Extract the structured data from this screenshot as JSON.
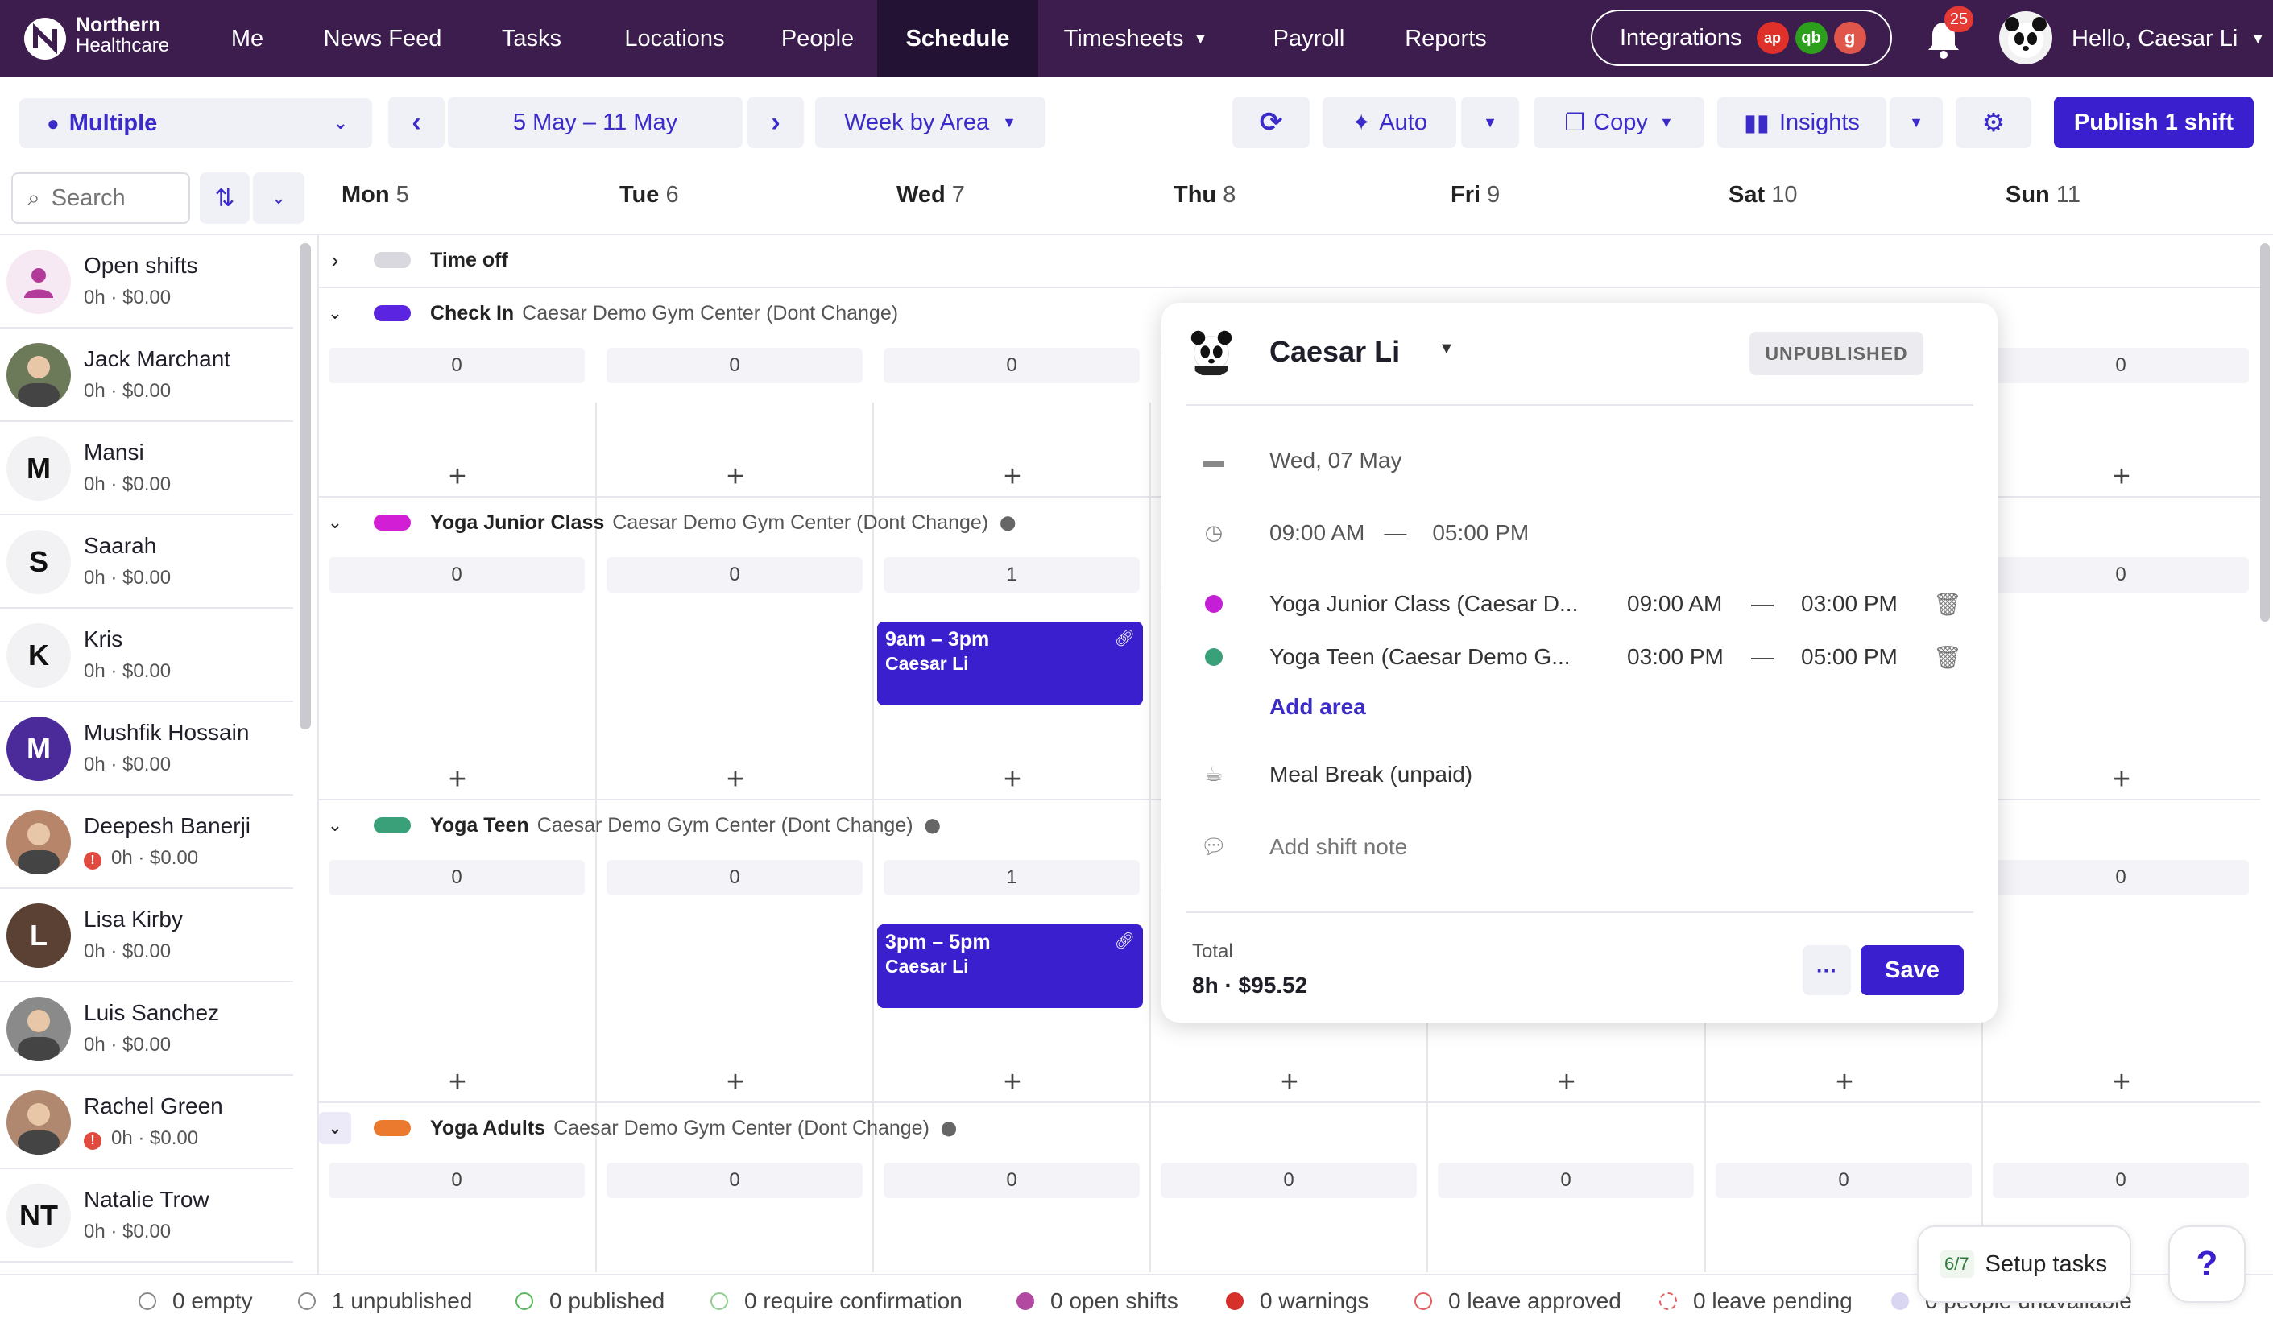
{
  "brand": {
    "line1": "Northern",
    "line2": "Healthcare"
  },
  "nav": {
    "items": [
      "Me",
      "News Feed",
      "Tasks",
      "Locations",
      "People",
      "Schedule",
      "Timesheets",
      "Payroll",
      "Reports"
    ],
    "active": "Schedule"
  },
  "integrations": {
    "label": "Integrations",
    "badges": [
      "ap",
      "qb",
      "g"
    ]
  },
  "notifications": {
    "count": "25"
  },
  "user": {
    "greeting": "Hello, Caesar Li"
  },
  "toolbar": {
    "location": "Multiple",
    "date_range": "5 May – 11 May",
    "view": "Week by Area",
    "auto": "Auto",
    "copy": "Copy",
    "insights": "Insights",
    "publish": "Publish 1 shift"
  },
  "search": {
    "placeholder": "Search"
  },
  "days": [
    {
      "d": "Mon",
      "n": "5"
    },
    {
      "d": "Tue",
      "n": "6"
    },
    {
      "d": "Wed",
      "n": "7"
    },
    {
      "d": "Thu",
      "n": "8"
    },
    {
      "d": "Fri",
      "n": "9"
    },
    {
      "d": "Sat",
      "n": "10"
    },
    {
      "d": "Sun",
      "n": "11"
    }
  ],
  "people": [
    {
      "name": "Open shifts",
      "meta": "0h · $0.00",
      "initials": "",
      "warn": false
    },
    {
      "name": "Jack Marchant",
      "meta": "0h · $0.00",
      "initials": "",
      "warn": false
    },
    {
      "name": "Mansi",
      "meta": "0h · $0.00",
      "initials": "M",
      "warn": false
    },
    {
      "name": "Saarah",
      "meta": "0h · $0.00",
      "initials": "S",
      "warn": false
    },
    {
      "name": "Kris",
      "meta": "0h · $0.00",
      "initials": "K",
      "warn": false
    },
    {
      "name": "Mushfik Hossain",
      "meta": "0h · $0.00",
      "initials": "M",
      "warn": false
    },
    {
      "name": "Deepesh Banerji",
      "meta": "0h · $0.00",
      "initials": "",
      "warn": true
    },
    {
      "name": "Lisa Kirby",
      "meta": "0h · $0.00",
      "initials": "L",
      "warn": false
    },
    {
      "name": "Luis Sanchez",
      "meta": "0h · $0.00",
      "initials": "",
      "warn": false
    },
    {
      "name": "Rachel Green",
      "meta": "0h · $0.00",
      "initials": "",
      "warn": true
    },
    {
      "name": "Natalie Trow",
      "meta": "0h · $0.00",
      "initials": "NT",
      "warn": false
    }
  ],
  "areas": {
    "time_off": "Time off",
    "check_in": {
      "name": "Check In",
      "loc": "Caesar Demo Gym Center (Dont Change)",
      "color": "#5a24e0",
      "counts": [
        "0",
        "0",
        "0",
        "0"
      ]
    },
    "yoga_junior": {
      "name": "Yoga Junior Class",
      "loc": "Caesar Demo Gym Center (Dont Change)",
      "color": "#d21fd6",
      "counts": [
        "0",
        "0",
        "1",
        "0"
      ]
    },
    "yoga_teen": {
      "name": "Yoga Teen",
      "loc": "Caesar Demo Gym Center (Dont Change)",
      "color": "#3aa07a",
      "counts": [
        "0",
        "0",
        "1",
        "0"
      ]
    },
    "yoga_adults": {
      "name": "Yoga Adults",
      "loc": "Caesar Demo Gym Center (Dont Change)",
      "color": "#ec7a2e",
      "counts": [
        "0",
        "0",
        "0",
        "0",
        "0",
        "0",
        "0"
      ]
    }
  },
  "shifts": [
    {
      "time": "9am – 3pm",
      "person": "Caesar Li"
    },
    {
      "time": "3pm – 5pm",
      "person": "Caesar Li"
    }
  ],
  "popup": {
    "name": "Caesar Li",
    "status": "UNPUBLISHED",
    "date": "Wed, 07 May",
    "start": "09:00 AM",
    "end": "05:00 PM",
    "dash": "—",
    "areas": [
      {
        "name": "Yoga Junior Class (Caesar D...",
        "start": "09:00 AM",
        "end": "03:00 PM",
        "color": "#c41fd6"
      },
      {
        "name": "Yoga Teen (Caesar Demo G...",
        "start": "03:00 PM",
        "end": "05:00 PM",
        "color": "#3aa07a"
      }
    ],
    "add_area": "Add area",
    "meal_break": "Meal Break (unpaid)",
    "note_placeholder": "Add shift note",
    "total_label": "Total",
    "total_value": "8h · $95.52",
    "more": "···",
    "save": "Save"
  },
  "legend": [
    {
      "label": "0 empty",
      "style": "empty"
    },
    {
      "label": "1 unpublished",
      "style": "unpub"
    },
    {
      "label": "0 published",
      "style": "pub"
    },
    {
      "label": "0 require confirmation",
      "style": "confirm"
    },
    {
      "label": "0 open shifts",
      "style": "open"
    },
    {
      "label": "0 warnings",
      "style": "warn"
    },
    {
      "label": "0 leave approved",
      "style": "leaveapp"
    },
    {
      "label": "0 leave pending",
      "style": "leavepend"
    },
    {
      "label": "0 people unavailable",
      "style": "unavail"
    }
  ],
  "setup": {
    "progress": "6/7",
    "label": "Setup tasks"
  },
  "help": {
    "label": "?"
  }
}
